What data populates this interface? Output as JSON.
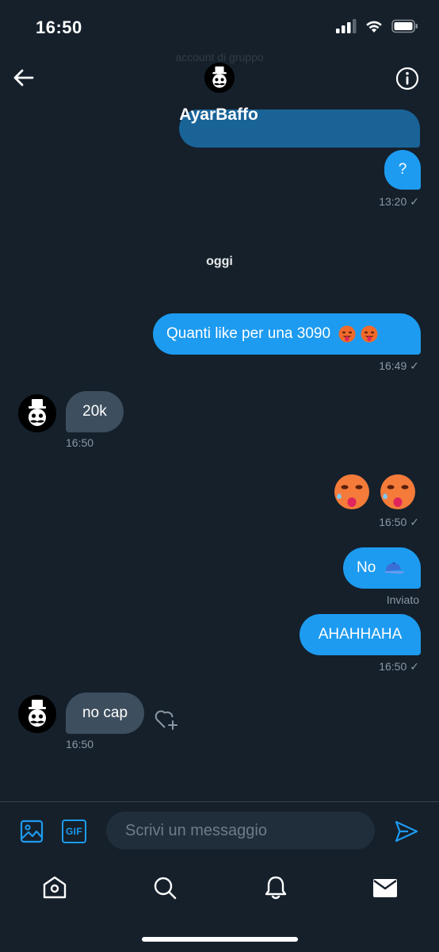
{
  "status_bar": {
    "time": "16:50"
  },
  "header": {
    "name": "AyarBaffo",
    "faded_subtitle": "account di gruppo"
  },
  "day_separator": "oggi",
  "messages": {
    "m1": {
      "text": "?",
      "time": "13:20"
    },
    "m2": {
      "text": "Quanti like per una 3090",
      "time": "16:49"
    },
    "m3": {
      "text": "20k",
      "time": "16:50"
    },
    "m4": {
      "time": "16:50"
    },
    "m5": {
      "text": "No",
      "status": "Inviato"
    },
    "m6": {
      "text": "AHAHHAHA",
      "time": "16:50"
    },
    "m7": {
      "text": "no cap",
      "time": "16:50"
    }
  },
  "composer": {
    "placeholder": "Scrivi un messaggio",
    "gif_label": "GIF"
  },
  "icons": {
    "back": "back-arrow-icon",
    "info": "info-icon",
    "image": "image-icon",
    "gif": "gif-icon",
    "send": "send-icon",
    "home": "home-icon",
    "search": "search-icon",
    "notifications": "bell-icon",
    "messages": "mail-icon"
  },
  "colors": {
    "background": "#15202b",
    "outgoing": "#1d9bf0",
    "incoming": "#3d4e5e",
    "accent": "#1d9bf0",
    "muted": "#8b98a5"
  }
}
